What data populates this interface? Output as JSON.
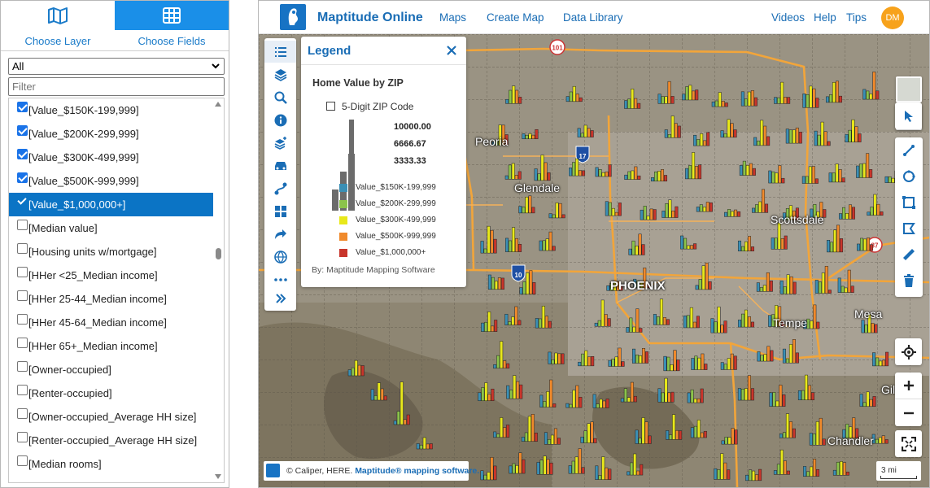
{
  "panel": {
    "tabs": [
      {
        "label": "Choose Layer",
        "icon": "map-icon"
      },
      {
        "label": "Choose Fields",
        "icon": "grid-icon"
      }
    ],
    "layer_select_value": "All",
    "filter_placeholder": "Filter",
    "fields": [
      {
        "label": "[Value_$150K-199,999]",
        "checked": true
      },
      {
        "label": "[Value_$200K-299,999]",
        "checked": true
      },
      {
        "label": "[Value_$300K-499,999]",
        "checked": true
      },
      {
        "label": "[Value_$500K-999,999]",
        "checked": true
      },
      {
        "label": "[Value_$1,000,000+]",
        "checked": true,
        "selected": true
      },
      {
        "label": "[Median value]",
        "checked": false
      },
      {
        "label": "[Housing units w/mortgage]",
        "checked": false
      },
      {
        "label": "[HHer <25_Median income]",
        "checked": false
      },
      {
        "label": "[HHer 25-44_Median income]",
        "checked": false
      },
      {
        "label": "[HHer 45-64_Median income]",
        "checked": false
      },
      {
        "label": "[HHer 65+_Median income]",
        "checked": false
      },
      {
        "label": "[Owner-occupied]",
        "checked": false
      },
      {
        "label": "[Renter-occupied]",
        "checked": false
      },
      {
        "label": "[Owner-occupied_Average HH size]",
        "checked": false
      },
      {
        "label": "[Renter-occupied_Average HH size]",
        "checked": false
      },
      {
        "label": "[Median rooms]",
        "checked": false
      }
    ]
  },
  "app": {
    "title": "Maptitude Online",
    "nav": [
      "Maps",
      "Create Map",
      "Data Library"
    ],
    "nav_right": [
      "Videos",
      "Help",
      "Tips"
    ],
    "avatar_initials": "DM"
  },
  "map": {
    "cities": [
      "Peoria",
      "Glendale",
      "Scottsdale",
      "PHOENIX",
      "Tempe",
      "Mesa",
      "Gil",
      "Chandler"
    ],
    "shields": [
      "101",
      "17",
      "10",
      "87"
    ],
    "attribution_prefix": "© Caliper, HERE.",
    "attribution_link": "Maptitude® mapping software.",
    "scale_label": "3 mi"
  },
  "legend": {
    "title": "Legend",
    "subtitle": "Home Value by ZIP",
    "layer_label": "5-Digit ZIP Code",
    "scale_values": [
      "10000.00",
      "6666.67",
      "3333.33"
    ],
    "items": [
      {
        "label": "Value_$150K-199,999",
        "color": "#3a8fb5"
      },
      {
        "label": "Value_$200K-299,999",
        "color": "#8bc34a"
      },
      {
        "label": "Value_$300K-499,999",
        "color": "#e8e81a"
      },
      {
        "label": "Value_$500K-999,999",
        "color": "#f08a2c"
      },
      {
        "label": "Value_$1,000,000+",
        "color": "#c8352b"
      }
    ],
    "credit": "By: Maptitude Mapping Software"
  },
  "colors": {
    "accent": "#1a8fe8",
    "brand_text": "#1a6db5",
    "selected_row": "#0b74c5",
    "avatar": "#f7a21b"
  }
}
